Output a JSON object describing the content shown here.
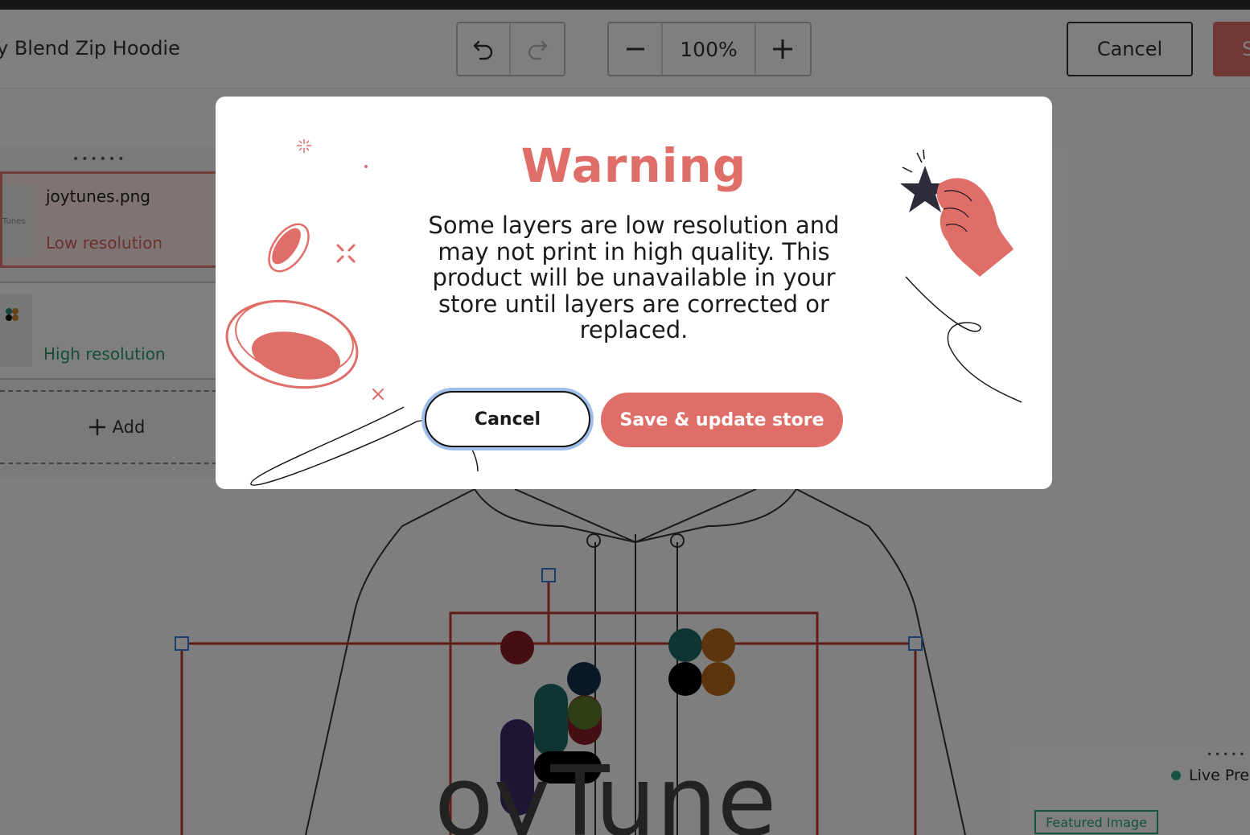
{
  "toolbar": {
    "product_title": "y Blend Zip Hoodie",
    "zoom_level": "100%",
    "zoom_out_icon": "minus-icon",
    "zoom_in_icon": "plus-icon",
    "undo_icon": "undo-icon",
    "redo_icon": "redo-icon",
    "cancel_label": "Cancel",
    "save_label": "S"
  },
  "layers": {
    "items": [
      {
        "name": "joytunes.png",
        "status": "Low resolution",
        "thumb_text": "Tunes"
      },
      {
        "name": "",
        "status": "High resolution",
        "thumb_text": ""
      }
    ],
    "add_label": "Add"
  },
  "preview": {
    "live_label": "Live Pre",
    "featured_label": "Featured Image"
  },
  "modal": {
    "title": "Warning",
    "message": "Some layers are low resolution and may not print in high quality. This product will be unavailable in your store until layers are corrected or replaced.",
    "cancel_label": "Cancel",
    "save_label": "Save & update store"
  },
  "colors": {
    "accent": "#e06e68",
    "low_resolution": "#d9625b",
    "high_resolution": "#2a9d6a",
    "focus_ring": "#9fbfe8"
  }
}
